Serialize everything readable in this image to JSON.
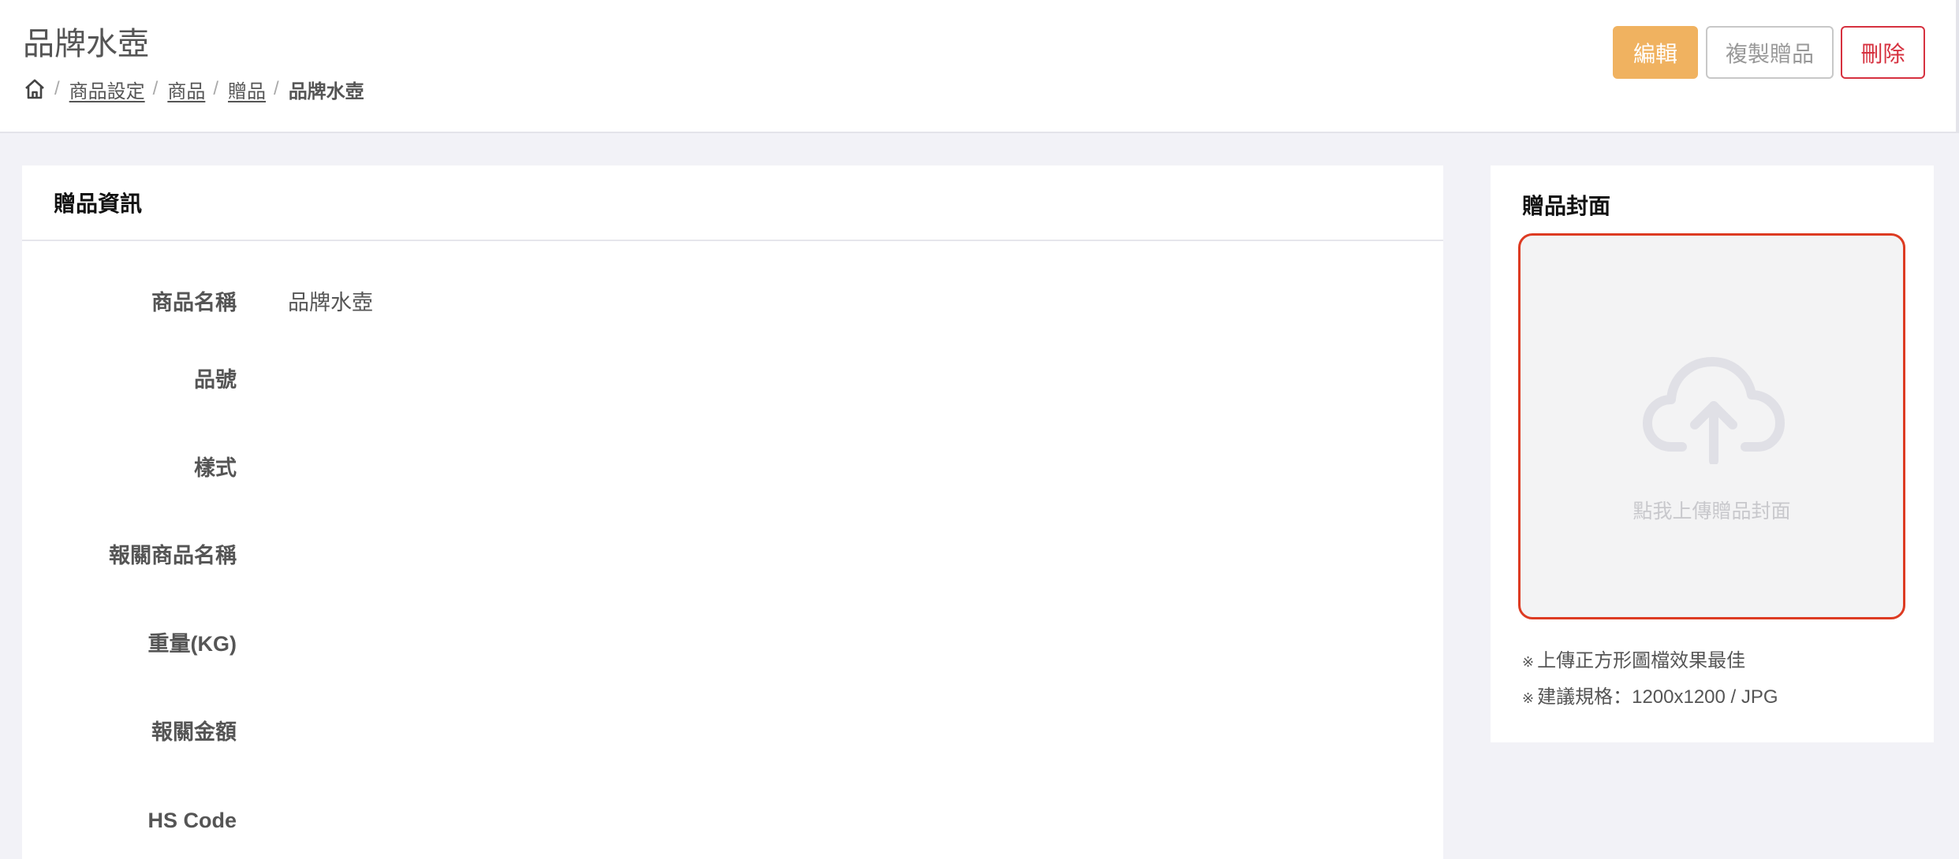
{
  "header": {
    "title": "品牌水壺",
    "breadcrumb": {
      "separator": "/",
      "items": [
        "商品設定",
        "商品",
        "贈品"
      ],
      "current": "品牌水壺"
    },
    "actions": {
      "edit": "編輯",
      "copy": "複製贈品",
      "delete": "刪除"
    }
  },
  "info_panel": {
    "title": "贈品資訊",
    "fields": [
      {
        "label": "商品名稱",
        "value": "品牌水壺"
      },
      {
        "label": "品號",
        "value": ""
      },
      {
        "label": "樣式",
        "value": ""
      },
      {
        "label": "報關商品名稱",
        "value": ""
      },
      {
        "label": "重量(KG)",
        "value": ""
      },
      {
        "label": "報關金額",
        "value": ""
      },
      {
        "label": "HS Code",
        "value": ""
      }
    ]
  },
  "cover_panel": {
    "title": "贈品封面",
    "upload_text": "點我上傳贈品封面",
    "note_mark": "※",
    "notes": [
      "上傳正方形圖檔效果最佳",
      "建議規格：1200x1200 / JPG"
    ]
  },
  "colors": {
    "accent": "#f0b260",
    "danger": "#d6313f",
    "upload_border": "#dd3b22",
    "background": "#f2f2f7"
  },
  "icons": {
    "home": "home-icon",
    "upload": "cloud-upload-icon"
  }
}
